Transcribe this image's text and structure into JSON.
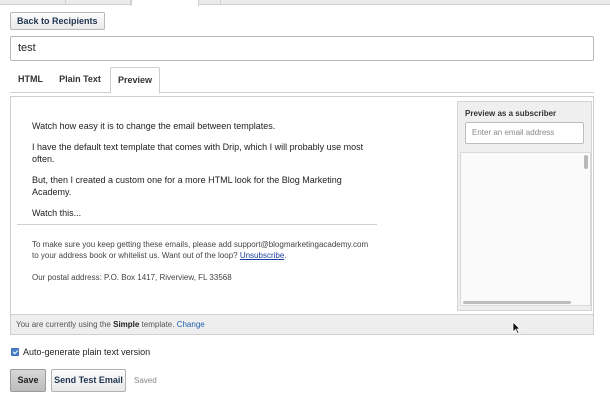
{
  "nav": {
    "back_label": "Back to Recipients"
  },
  "subject": {
    "value": "test"
  },
  "tabs": [
    {
      "label": "HTML"
    },
    {
      "label": "Plain Text"
    },
    {
      "label": "Preview"
    }
  ],
  "preview": {
    "paragraphs": [
      "Watch how easy it is to change the email between templates.",
      "I have the default text template that comes with Drip, which I will probably use most often.",
      "But, then I created a custom one for a more HTML look for the Blog Marketing Academy.",
      "Watch this..."
    ],
    "footer_line1": "To make sure you keep getting these emails, please add support@blogmarketingacademy.com to your address book or whitelist us. Want out of the loop? ",
    "unsubscribe_label": "Unsubscribe",
    "footer_end": ".",
    "postal": "Our postal address: P.O. Box 1417, Riverview, FL 33568"
  },
  "subscriber_preview": {
    "title": "Preview as a subscriber",
    "placeholder": "Enter an email address"
  },
  "template_status": {
    "prefix": "You are currently using the ",
    "template_name": "Simple",
    "suffix": " template. ",
    "change_label": "Change"
  },
  "options": {
    "auto_generate_label": "Auto-generate plain text version",
    "auto_generate_checked": true
  },
  "actions": {
    "save_label": "Save",
    "send_test_label": "Send Test Email",
    "status": "Saved"
  },
  "colors": {
    "link": "#1a3fa0",
    "accent": "#4a7fc7"
  }
}
